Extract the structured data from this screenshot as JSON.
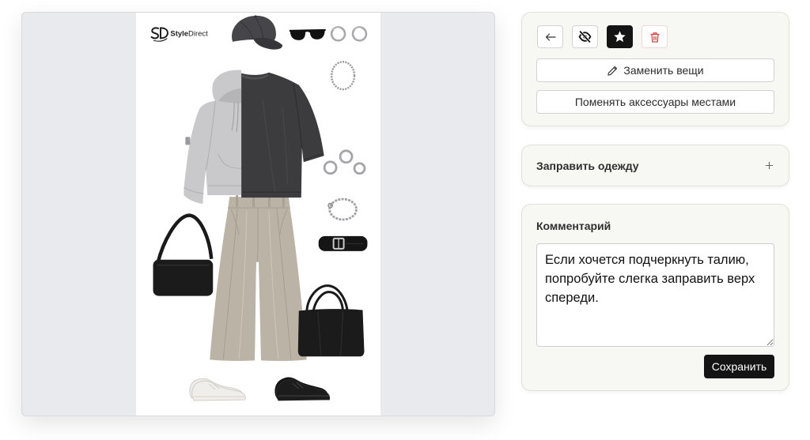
{
  "outfit_image": {
    "brand_logo": {
      "part_bold": "Style",
      "part_light": "Direct"
    }
  },
  "toolbar": {
    "back": {
      "icon": "arrow-left-icon"
    },
    "hide": {
      "icon": "eye-off-icon"
    },
    "favorite": {
      "icon": "star-icon",
      "active": true
    },
    "delete": {
      "icon": "trash-icon"
    }
  },
  "actions": {
    "replace_items": {
      "label": "Заменить вещи",
      "icon": "pencil-icon"
    },
    "swap_accessories": {
      "label": "Поменять аксессуары местами"
    }
  },
  "tuck_section": {
    "title": "Заправить одежду",
    "icon": "plus-icon",
    "expanded": false
  },
  "comment": {
    "label": "Комментарий",
    "value": "Если хочется подчеркнуть талию, попробуйте слегка заправить верх спереди.",
    "save_label": "Сохранить"
  },
  "colors": {
    "page_bg": "#ffffff",
    "viewer_bg": "#e9eaee",
    "card_bg": "#f7f7f3",
    "accent": "#141414",
    "danger": "#d64545"
  }
}
